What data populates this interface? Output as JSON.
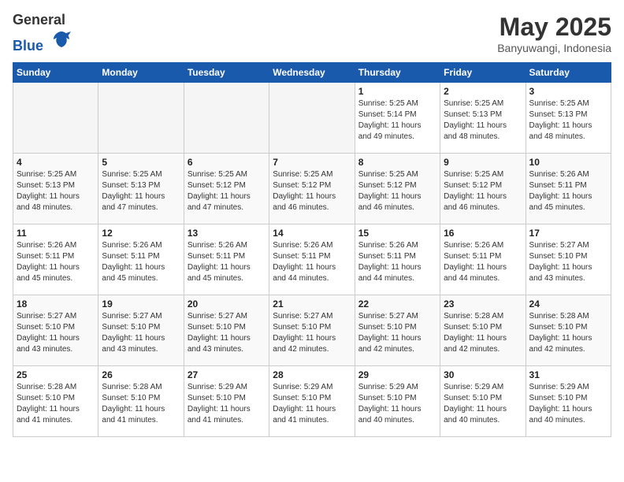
{
  "header": {
    "logo_line1": "General",
    "logo_line2": "Blue",
    "month": "May 2025",
    "location": "Banyuwangi, Indonesia"
  },
  "weekdays": [
    "Sunday",
    "Monday",
    "Tuesday",
    "Wednesday",
    "Thursday",
    "Friday",
    "Saturday"
  ],
  "weeks": [
    [
      {
        "day": "",
        "info": ""
      },
      {
        "day": "",
        "info": ""
      },
      {
        "day": "",
        "info": ""
      },
      {
        "day": "",
        "info": ""
      },
      {
        "day": "1",
        "info": "Sunrise: 5:25 AM\nSunset: 5:14 PM\nDaylight: 11 hours\nand 49 minutes."
      },
      {
        "day": "2",
        "info": "Sunrise: 5:25 AM\nSunset: 5:13 PM\nDaylight: 11 hours\nand 48 minutes."
      },
      {
        "day": "3",
        "info": "Sunrise: 5:25 AM\nSunset: 5:13 PM\nDaylight: 11 hours\nand 48 minutes."
      }
    ],
    [
      {
        "day": "4",
        "info": "Sunrise: 5:25 AM\nSunset: 5:13 PM\nDaylight: 11 hours\nand 48 minutes."
      },
      {
        "day": "5",
        "info": "Sunrise: 5:25 AM\nSunset: 5:13 PM\nDaylight: 11 hours\nand 47 minutes."
      },
      {
        "day": "6",
        "info": "Sunrise: 5:25 AM\nSunset: 5:12 PM\nDaylight: 11 hours\nand 47 minutes."
      },
      {
        "day": "7",
        "info": "Sunrise: 5:25 AM\nSunset: 5:12 PM\nDaylight: 11 hours\nand 46 minutes."
      },
      {
        "day": "8",
        "info": "Sunrise: 5:25 AM\nSunset: 5:12 PM\nDaylight: 11 hours\nand 46 minutes."
      },
      {
        "day": "9",
        "info": "Sunrise: 5:25 AM\nSunset: 5:12 PM\nDaylight: 11 hours\nand 46 minutes."
      },
      {
        "day": "10",
        "info": "Sunrise: 5:26 AM\nSunset: 5:11 PM\nDaylight: 11 hours\nand 45 minutes."
      }
    ],
    [
      {
        "day": "11",
        "info": "Sunrise: 5:26 AM\nSunset: 5:11 PM\nDaylight: 11 hours\nand 45 minutes."
      },
      {
        "day": "12",
        "info": "Sunrise: 5:26 AM\nSunset: 5:11 PM\nDaylight: 11 hours\nand 45 minutes."
      },
      {
        "day": "13",
        "info": "Sunrise: 5:26 AM\nSunset: 5:11 PM\nDaylight: 11 hours\nand 45 minutes."
      },
      {
        "day": "14",
        "info": "Sunrise: 5:26 AM\nSunset: 5:11 PM\nDaylight: 11 hours\nand 44 minutes."
      },
      {
        "day": "15",
        "info": "Sunrise: 5:26 AM\nSunset: 5:11 PM\nDaylight: 11 hours\nand 44 minutes."
      },
      {
        "day": "16",
        "info": "Sunrise: 5:26 AM\nSunset: 5:11 PM\nDaylight: 11 hours\nand 44 minutes."
      },
      {
        "day": "17",
        "info": "Sunrise: 5:27 AM\nSunset: 5:10 PM\nDaylight: 11 hours\nand 43 minutes."
      }
    ],
    [
      {
        "day": "18",
        "info": "Sunrise: 5:27 AM\nSunset: 5:10 PM\nDaylight: 11 hours\nand 43 minutes."
      },
      {
        "day": "19",
        "info": "Sunrise: 5:27 AM\nSunset: 5:10 PM\nDaylight: 11 hours\nand 43 minutes."
      },
      {
        "day": "20",
        "info": "Sunrise: 5:27 AM\nSunset: 5:10 PM\nDaylight: 11 hours\nand 43 minutes."
      },
      {
        "day": "21",
        "info": "Sunrise: 5:27 AM\nSunset: 5:10 PM\nDaylight: 11 hours\nand 42 minutes."
      },
      {
        "day": "22",
        "info": "Sunrise: 5:27 AM\nSunset: 5:10 PM\nDaylight: 11 hours\nand 42 minutes."
      },
      {
        "day": "23",
        "info": "Sunrise: 5:28 AM\nSunset: 5:10 PM\nDaylight: 11 hours\nand 42 minutes."
      },
      {
        "day": "24",
        "info": "Sunrise: 5:28 AM\nSunset: 5:10 PM\nDaylight: 11 hours\nand 42 minutes."
      }
    ],
    [
      {
        "day": "25",
        "info": "Sunrise: 5:28 AM\nSunset: 5:10 PM\nDaylight: 11 hours\nand 41 minutes."
      },
      {
        "day": "26",
        "info": "Sunrise: 5:28 AM\nSunset: 5:10 PM\nDaylight: 11 hours\nand 41 minutes."
      },
      {
        "day": "27",
        "info": "Sunrise: 5:29 AM\nSunset: 5:10 PM\nDaylight: 11 hours\nand 41 minutes."
      },
      {
        "day": "28",
        "info": "Sunrise: 5:29 AM\nSunset: 5:10 PM\nDaylight: 11 hours\nand 41 minutes."
      },
      {
        "day": "29",
        "info": "Sunrise: 5:29 AM\nSunset: 5:10 PM\nDaylight: 11 hours\nand 40 minutes."
      },
      {
        "day": "30",
        "info": "Sunrise: 5:29 AM\nSunset: 5:10 PM\nDaylight: 11 hours\nand 40 minutes."
      },
      {
        "day": "31",
        "info": "Sunrise: 5:29 AM\nSunset: 5:10 PM\nDaylight: 11 hours\nand 40 minutes."
      }
    ]
  ]
}
